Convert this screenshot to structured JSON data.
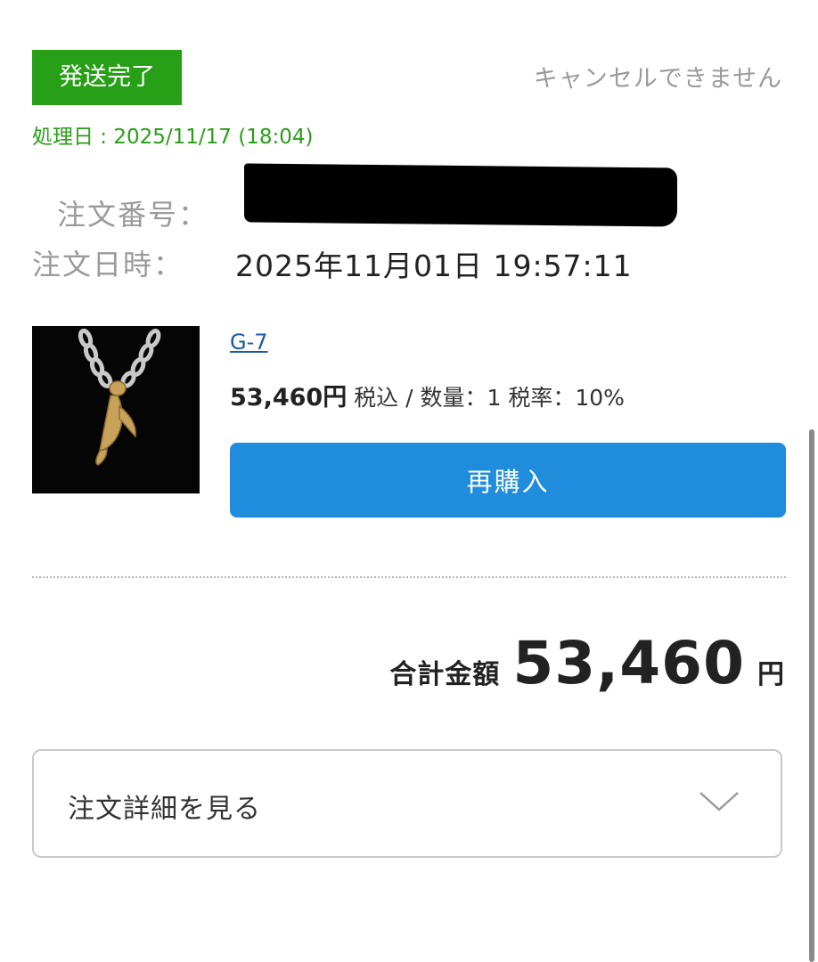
{
  "status": {
    "badge_label": "発送完了",
    "badge_color": "#279f16",
    "cancel_note": "キャンセルできません",
    "processed_date": "処理日 : 2025/11/17 (18:04)"
  },
  "order": {
    "number_label": "注文番号：",
    "number_value_redacted": true,
    "date_label": "注文日時：",
    "date_value": "2025年11月01日 19:57:11"
  },
  "item": {
    "image_description_icon": "gold-eagle-pendant-necklace",
    "name": "G-7",
    "price": "53,460円",
    "details": " 税込 / 数量：1 税率：10%",
    "rebuy_label": "再購入",
    "rebuy_color": "#1f8cdc"
  },
  "total": {
    "label": "合計金額",
    "value": "53,460",
    "currency": "円"
  },
  "details_toggle": {
    "label": "注文詳細を見る",
    "icon": "chevron-down-icon"
  }
}
